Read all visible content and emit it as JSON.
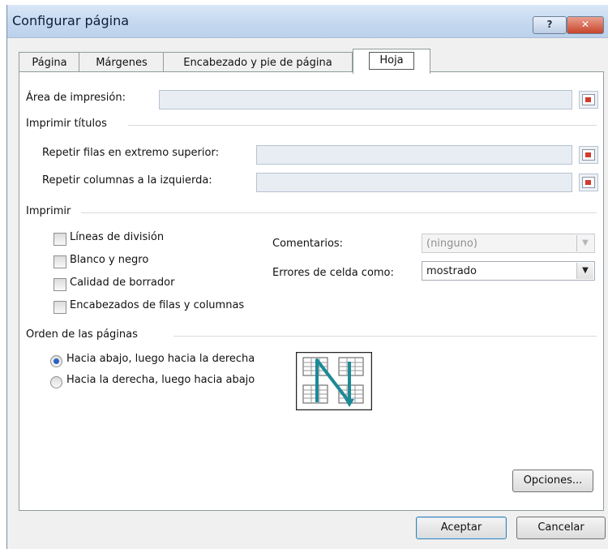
{
  "window": {
    "title": "Configurar página",
    "help_label": "?",
    "close_label": "✕"
  },
  "tabs": [
    {
      "label": "Página",
      "active": false
    },
    {
      "label": "Márgenes",
      "active": false
    },
    {
      "label": "Encabezado y pie de página",
      "active": false
    },
    {
      "label": "Hoja",
      "active": true
    }
  ],
  "print_area": {
    "label": "Área de impresión:",
    "value": ""
  },
  "print_titles": {
    "group_label": "Imprimir títulos",
    "rows_label": "Repetir filas en extremo superior:",
    "rows_value": "",
    "cols_label": "Repetir columnas a la izquierda:",
    "cols_value": ""
  },
  "print": {
    "group_label": "Imprimir",
    "checkboxes": [
      {
        "label": "Líneas de división",
        "checked": false
      },
      {
        "label": "Blanco y negro",
        "checked": false
      },
      {
        "label": "Calidad de borrador",
        "checked": false
      },
      {
        "label": "Encabezados de filas y columnas",
        "checked": false
      }
    ],
    "comments_label": "Comentarios:",
    "comments_value": "(ninguno)",
    "errors_label": "Errores de celda como:",
    "errors_value": "mostrado"
  },
  "page_order": {
    "group_label": "Orden de las páginas",
    "options": [
      {
        "label": "Hacia abajo, luego hacia la derecha",
        "selected": true
      },
      {
        "label": "Hacia la derecha, luego hacia abajo",
        "selected": false
      }
    ]
  },
  "buttons": {
    "options": "Opciones...",
    "ok": "Aceptar",
    "cancel": "Cancelar"
  },
  "colors": {
    "accent": "#2a63c4",
    "order_arrow": "#1a8a96",
    "close_button": "#c7452b"
  }
}
